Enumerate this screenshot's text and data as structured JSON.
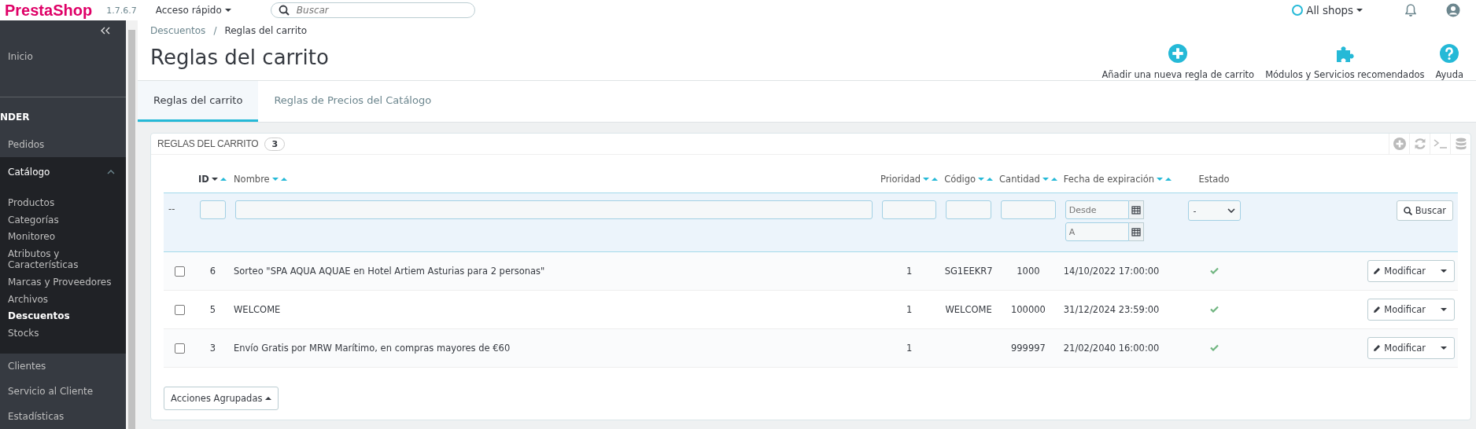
{
  "topbar": {
    "logo": "PrestaShop",
    "version": "1.7.6.7",
    "quick_access": "Acceso rápido",
    "search": {
      "placeholder": "Buscar"
    },
    "shop": "All shops"
  },
  "sidebar": {
    "items": [
      {
        "label": "Inicio",
        "kind": "item",
        "selected": false
      },
      {
        "label": "NDER",
        "kind": "section"
      },
      {
        "label": "Pedidos",
        "kind": "item",
        "selected": false
      },
      {
        "label": "Catálogo",
        "kind": "item",
        "selected": false,
        "expanded": true,
        "children": [
          {
            "label": "Productos",
            "selected": false
          },
          {
            "label": "Categorías",
            "selected": false
          },
          {
            "label": "Monitoreo",
            "selected": false
          },
          {
            "label": "Atributos y Características",
            "selected": false
          },
          {
            "label": "Marcas y Proveedores",
            "selected": false
          },
          {
            "label": "Archivos",
            "selected": false
          },
          {
            "label": "Descuentos",
            "selected": true
          },
          {
            "label": "Stocks",
            "selected": false
          }
        ]
      },
      {
        "label": "Clientes",
        "kind": "item",
        "selected": false
      },
      {
        "label": "Servicio al Cliente",
        "kind": "item",
        "selected": false
      },
      {
        "label": "Estadísticas",
        "kind": "item",
        "selected": false
      }
    ]
  },
  "breadcrumb": [
    "Descuentos",
    "/",
    "Reglas del carrito"
  ],
  "page_title": "Reglas del carrito",
  "toolbar": [
    {
      "kind": "add",
      "label": "Añadir una nueva regla de carrito"
    },
    {
      "kind": "puzzle",
      "label": "Módulos y Servicios recomendados"
    },
    {
      "kind": "help",
      "label": "Ayuda"
    }
  ],
  "tabs": [
    {
      "label": "Reglas del carrito",
      "selected": true
    },
    {
      "label": "Reglas de Precios del Catálogo",
      "selected": false
    }
  ],
  "panel": {
    "title": "REGLAS DEL CARRITO",
    "count": "3",
    "tools": [
      {
        "kind": "add"
      },
      {
        "kind": "refresh"
      },
      {
        "kind": "terminal"
      },
      {
        "kind": "database"
      }
    ],
    "table": {
      "columns": [
        {
          "label": "ID",
          "sortable": true,
          "sorted": true
        },
        {
          "label": "Nombre",
          "sortable": true,
          "sorted": false
        },
        {
          "label": "Prioridad",
          "sortable": true,
          "sorted": false
        },
        {
          "label": "Código",
          "sortable": true,
          "sorted": false
        },
        {
          "label": "Cantidad",
          "sortable": true,
          "sorted": false
        },
        {
          "label": "Fecha de expiración",
          "sortable": true,
          "sorted": false
        },
        {
          "label": "Estado",
          "sortable": false
        }
      ],
      "filters": {
        "marker": "--",
        "date_from": {
          "placeholder": "Desde"
        },
        "date_to": {
          "placeholder": "A"
        },
        "status": "-",
        "search_button": "Buscar"
      },
      "rows": [
        {
          "checked": false,
          "id": "6",
          "name": "Sorteo \"SPA AQUA AQUAE en Hotel Artiem Asturias para 2 personas\"",
          "priority": "1",
          "code": "SG1EEKR7",
          "quantity": "1000",
          "expiry": "14/10/2022 17:00:00",
          "active": true,
          "action": "Modificar"
        },
        {
          "checked": false,
          "id": "5",
          "name": "WELCOME",
          "priority": "1",
          "code": "WELCOME",
          "quantity": "100000",
          "expiry": "31/12/2024 23:59:00",
          "active": true,
          "action": "Modificar"
        },
        {
          "checked": false,
          "id": "3",
          "name": "Envío Gratis por MRW Marítimo, en compras mayores de €60",
          "priority": "1",
          "quantity": "999997",
          "expiry": "21/02/2040 16:00:00",
          "active": true,
          "action": "Modificar"
        }
      ]
    },
    "bulk_button": "Acciones Agrupadas"
  }
}
